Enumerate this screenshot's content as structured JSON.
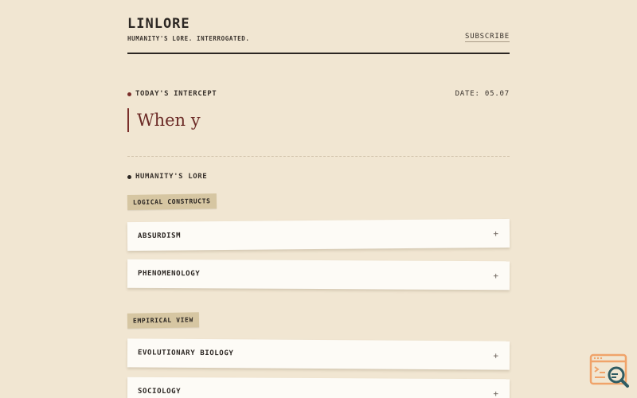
{
  "brand": {
    "title": "LINLORE",
    "tagline": "HUMANITY'S LORE. INTERROGATED."
  },
  "nav": {
    "subscribe": "SUBSCRIBE"
  },
  "intercept": {
    "label": "TODAY'S INTERCEPT",
    "date": "DATE: 05.07",
    "typed_text": "When y"
  },
  "lore": {
    "label": "HUMANITY'S LORE",
    "groups": [
      {
        "tag": "LOGICAL CONSTRUCTS",
        "items": [
          {
            "label": "ABSURDISM",
            "toggle": "+"
          },
          {
            "label": "PHENOMENOLOGY",
            "toggle": "+"
          }
        ]
      },
      {
        "tag": "EMPIRICAL VIEW",
        "items": [
          {
            "label": "EVOLUTIONARY BIOLOGY",
            "toggle": "+"
          },
          {
            "label": "SOCIOLOGY",
            "toggle": "+"
          }
        ]
      }
    ]
  },
  "colors": {
    "background": "#f1e6d2",
    "ink": "#2b2622",
    "accent": "#7a2e2a",
    "tape": "#d6c6a2",
    "card": "#fdfbf6",
    "widget": "#f0a36a",
    "widget_lens": "#2f5c63"
  },
  "icons": {
    "help_widget": "search-document-icon"
  }
}
